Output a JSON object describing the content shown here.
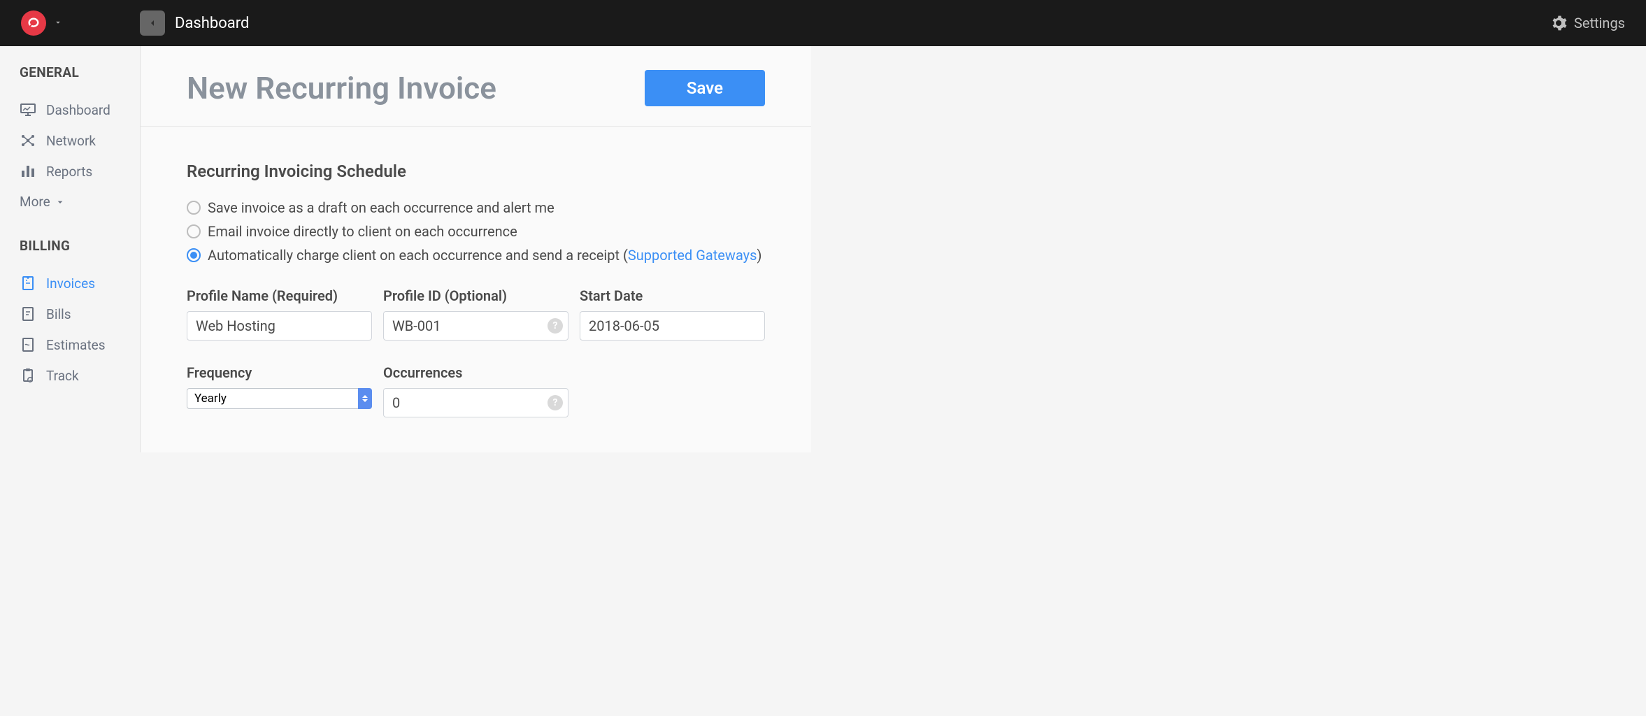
{
  "topbar": {
    "breadcrumb": "Dashboard",
    "settings_label": "Settings"
  },
  "sidebar": {
    "section_general": "GENERAL",
    "section_billing": "BILLING",
    "more_label": "More",
    "items_general": [
      {
        "label": "Dashboard"
      },
      {
        "label": "Network"
      },
      {
        "label": "Reports"
      }
    ],
    "items_billing": [
      {
        "label": "Invoices"
      },
      {
        "label": "Bills"
      },
      {
        "label": "Estimates"
      },
      {
        "label": "Track"
      }
    ]
  },
  "page": {
    "title": "New Recurring Invoice",
    "save_label": "Save"
  },
  "schedule": {
    "section_title": "Recurring Invoicing Schedule",
    "opt_draft": "Save invoice as a draft on each occurrence and alert me",
    "opt_email": "Email invoice directly to client on each occurrence",
    "opt_charge_pre": "Automatically charge client on each occurrence and send a receipt (",
    "opt_charge_link": "Supported Gateways",
    "opt_charge_post": ")"
  },
  "fields": {
    "profile_name_label": "Profile Name (Required)",
    "profile_name_value": "Web Hosting",
    "profile_id_label": "Profile ID (Optional)",
    "profile_id_value": "WB-001",
    "start_date_label": "Start Date",
    "start_date_value": "2018-06-05",
    "frequency_label": "Frequency",
    "frequency_value": "Yearly",
    "occurrences_label": "Occurrences",
    "occurrences_value": "0"
  },
  "help_glyph": "?"
}
